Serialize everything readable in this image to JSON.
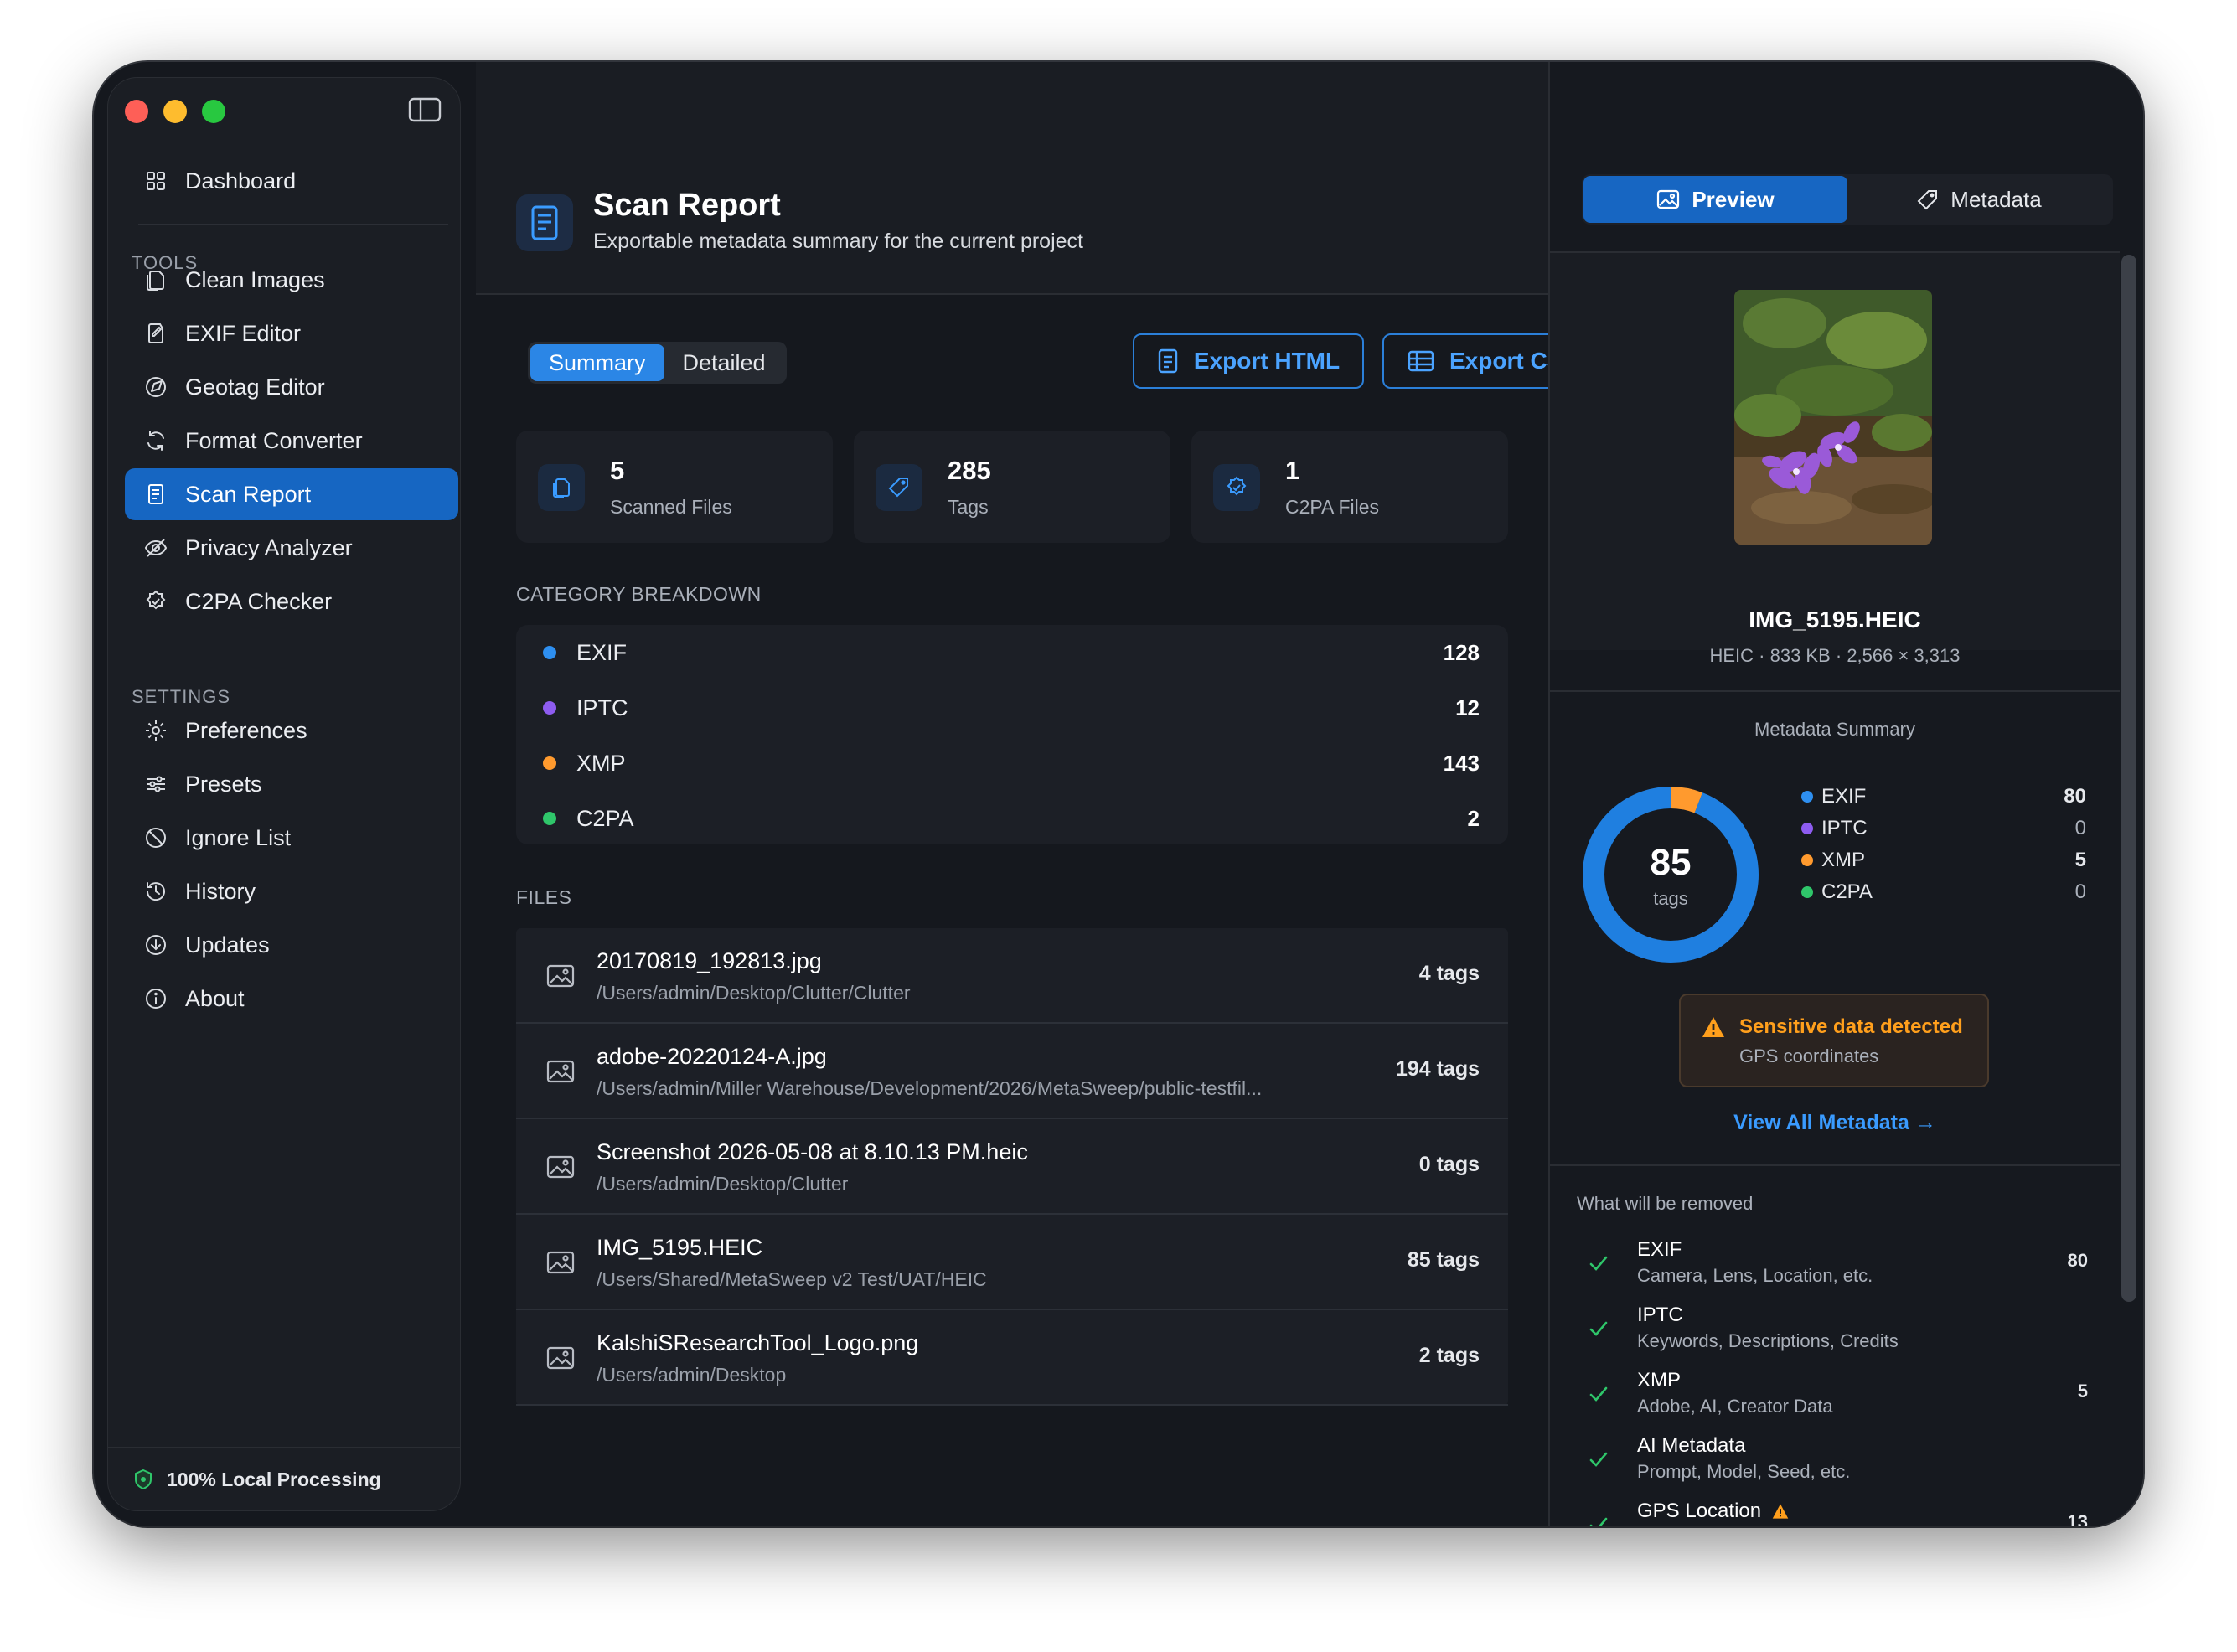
{
  "sidebar": {
    "dashboard": "Dashboard",
    "tools_heading": "TOOLS",
    "tools": [
      "Clean Images",
      "EXIF Editor",
      "Geotag Editor",
      "Format Converter",
      "Scan Report",
      "Privacy Analyzer",
      "C2PA Checker"
    ],
    "settings_heading": "SETTINGS",
    "settings": [
      "Preferences",
      "Presets",
      "Ignore List",
      "History",
      "Updates",
      "About"
    ],
    "footer": "100% Local Processing"
  },
  "header": {
    "title": "Scan Report",
    "subtitle": "Exportable metadata summary for the current project"
  },
  "view_toggle": {
    "summary": "Summary",
    "detailed": "Detailed"
  },
  "export": {
    "html": "Export HTML",
    "csv": "Export CSV"
  },
  "stats": [
    {
      "value": "5",
      "label": "Scanned Files"
    },
    {
      "value": "285",
      "label": "Tags"
    },
    {
      "value": "1",
      "label": "C2PA Files"
    }
  ],
  "category_breakdown": {
    "title": "CATEGORY BREAKDOWN",
    "rows": [
      {
        "name": "EXIF",
        "value": "128",
        "color": "#2e8ff0"
      },
      {
        "name": "IPTC",
        "value": "12",
        "color": "#8e5cf0"
      },
      {
        "name": "XMP",
        "value": "143",
        "color": "#ff9a2e"
      },
      {
        "name": "C2PA",
        "value": "2",
        "color": "#2fc66a"
      }
    ]
  },
  "files": {
    "title": "FILES",
    "rows": [
      {
        "name": "20170819_192813.jpg",
        "path": "/Users/admin/Desktop/Clutter/Clutter",
        "tags": "4 tags"
      },
      {
        "name": "adobe-20220124-A.jpg",
        "path": "/Users/admin/Miller Warehouse/Development/2026/MetaSweep/public-testfil...",
        "tags": "194 tags"
      },
      {
        "name": "Screenshot 2026-05-08 at 8.10.13 PM.heic",
        "path": "/Users/admin/Desktop/Clutter",
        "tags": "0 tags"
      },
      {
        "name": "IMG_5195.HEIC",
        "path": "/Users/Shared/MetaSweep v2 Test/UAT/HEIC",
        "tags": "85 tags"
      },
      {
        "name": "KalshiSResearchTool_Logo.png",
        "path": "/Users/admin/Desktop",
        "tags": "2 tags"
      }
    ]
  },
  "right_panel": {
    "tabs": {
      "preview": "Preview",
      "metadata": "Metadata"
    },
    "file_name": "IMG_5195.HEIC",
    "file_info": "HEIC · 833 KB · 2,566 × 3,313",
    "summary_title": "Metadata Summary",
    "total": "85",
    "total_label": "tags",
    "legend": [
      {
        "name": "EXIF",
        "value": 80,
        "color": "#2e8ff0"
      },
      {
        "name": "IPTC",
        "value": 0,
        "color": "#8e5cf0"
      },
      {
        "name": "XMP",
        "value": 5,
        "color": "#ff9a2e"
      },
      {
        "name": "C2PA",
        "value": 0,
        "color": "#2fc66a"
      }
    ],
    "warning": {
      "title": "Sensitive data detected",
      "subtitle": "GPS coordinates"
    },
    "view_all": "View All Metadata →",
    "removal_title": "What will be removed",
    "removals": [
      {
        "title": "EXIF",
        "subtitle": "Camera, Lens, Location, etc.",
        "value": "80"
      },
      {
        "title": "IPTC",
        "subtitle": "Keywords, Descriptions, Credits",
        "value": ""
      },
      {
        "title": "XMP",
        "subtitle": "Adobe, AI, Creator Data",
        "value": "5"
      },
      {
        "title": "AI Metadata",
        "subtitle": "Prompt, Model, Seed, etc.",
        "value": ""
      },
      {
        "title": "GPS Location",
        "subtitle": "",
        "value": "13"
      }
    ]
  },
  "colors": {
    "accent": "#1666c2",
    "link": "#3a9bff",
    "warning": "#ff9f1c",
    "success": "#2fc66a"
  }
}
